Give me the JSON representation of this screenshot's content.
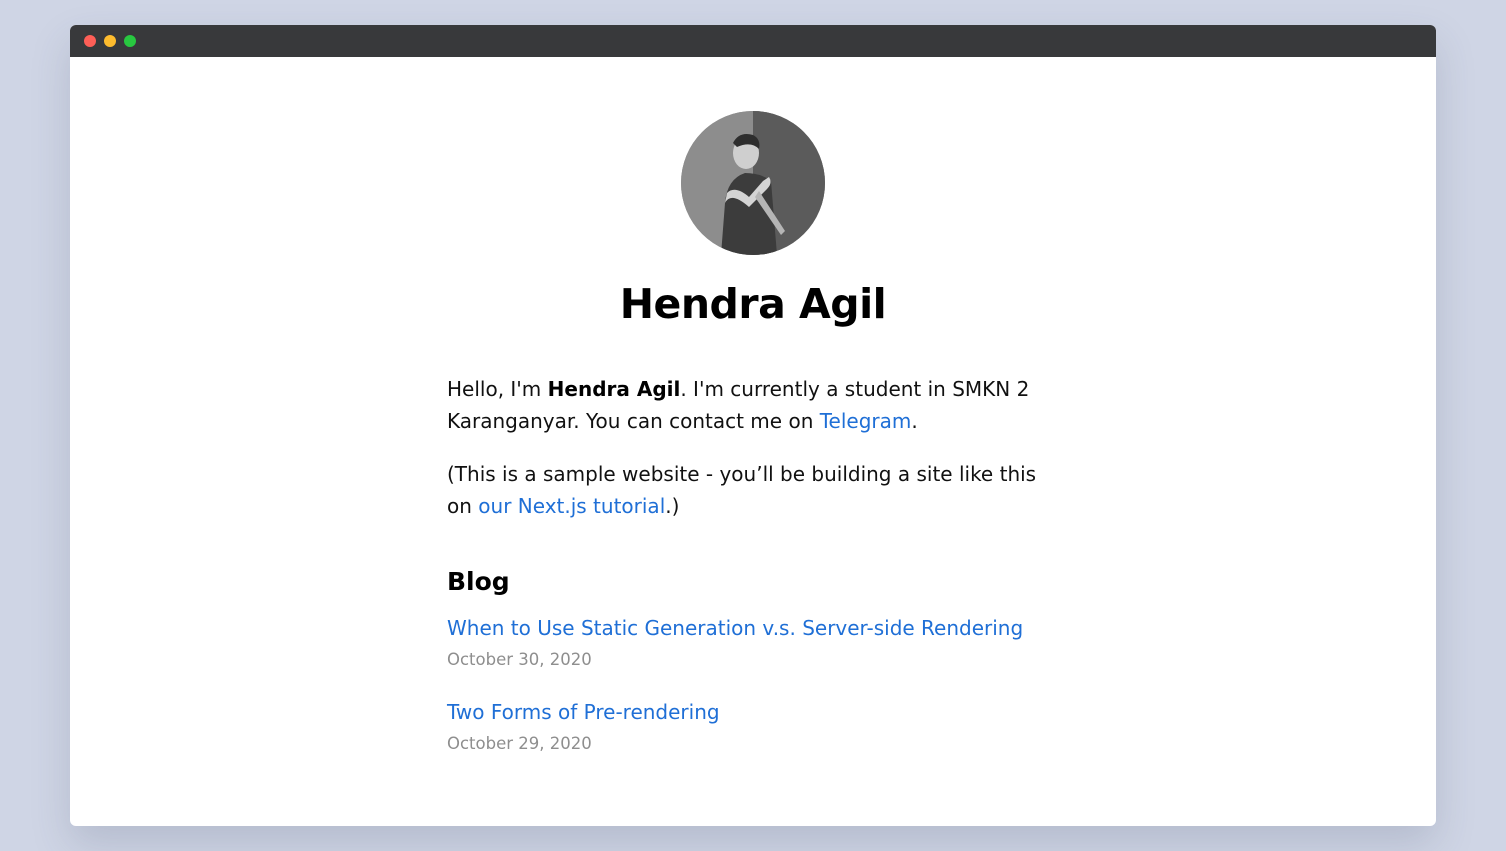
{
  "window": {
    "controls": {
      "close_color": "#fe5f57",
      "minimize_color": "#febc2e",
      "maximize_color": "#28c840"
    }
  },
  "profile": {
    "avatar_icon": "profile-photo",
    "name": "Hendra Agil"
  },
  "intro": {
    "p1_before": "Hello, I'm ",
    "p1_name": "Hendra Agil",
    "p1_middle": ". I'm currently a student in SMKN 2 Karanganyar. You can contact me on ",
    "p1_link": "Telegram",
    "p1_after": ".",
    "p2_before": "(This is a sample website - you’ll be building a site like this on ",
    "p2_link": "our Next.js tutorial",
    "p2_after": ".)"
  },
  "blog": {
    "heading": "Blog",
    "posts": [
      {
        "title": "When to Use Static Generation v.s. Server-side Rendering",
        "date": "October 30, 2020"
      },
      {
        "title": "Two Forms of Pre-rendering",
        "date": "October 29, 2020"
      }
    ]
  },
  "colors": {
    "link": "#1f6fd6",
    "date": "#8e8e8e",
    "titlebar": "#38393b",
    "backdrop": "#cfd5e5"
  }
}
